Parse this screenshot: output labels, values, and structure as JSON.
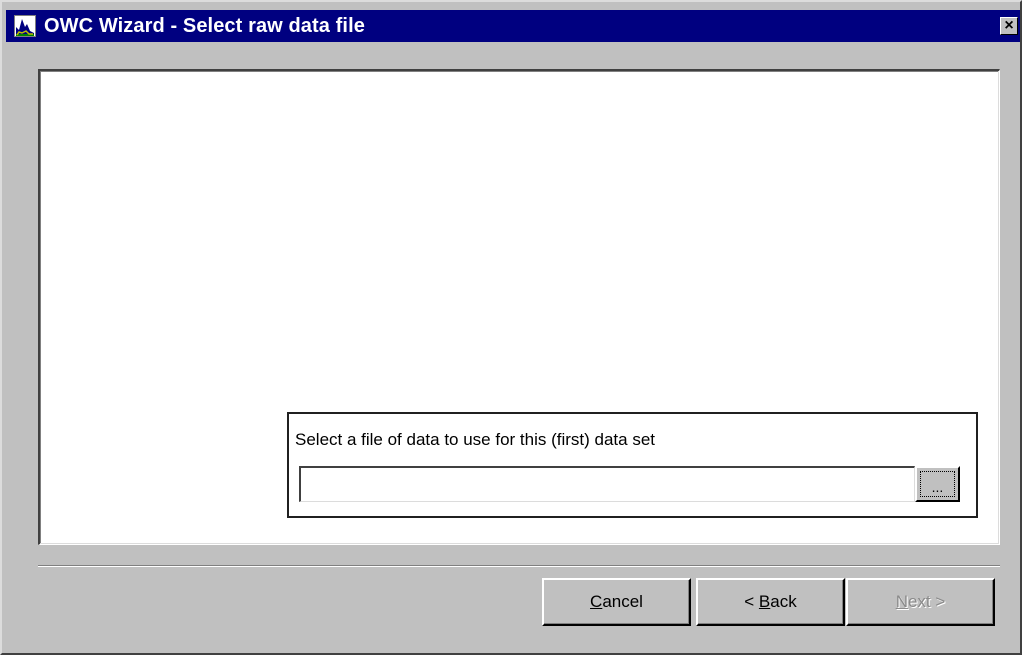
{
  "window": {
    "title": "OWC Wizard - Select raw data file",
    "close_glyph": "×",
    "icon": "chart-app-icon"
  },
  "file_select": {
    "label": "Select a file of data to use for this (first) data set",
    "value": "",
    "browse_label": "..."
  },
  "buttons": {
    "cancel": {
      "mnemonic": "C",
      "rest": "ancel",
      "enabled": true
    },
    "back": {
      "prefix": "< ",
      "mnemonic": "B",
      "rest": "ack",
      "enabled": true
    },
    "next": {
      "mnemonic": "N",
      "rest": "ext >",
      "enabled": false
    }
  },
  "colors": {
    "titlebar": "#000080",
    "face": "#c0c0c0",
    "panel": "#ffffff"
  }
}
